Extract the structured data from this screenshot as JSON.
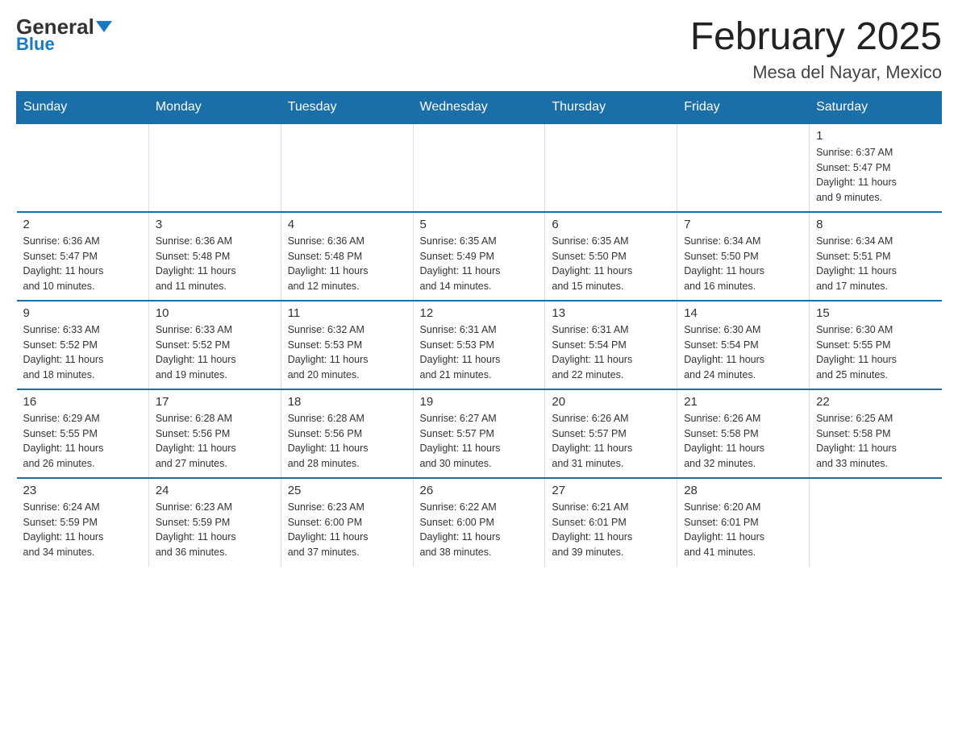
{
  "header": {
    "logo_general": "General",
    "logo_blue": "Blue",
    "title": "February 2025",
    "subtitle": "Mesa del Nayar, Mexico"
  },
  "days_of_week": [
    "Sunday",
    "Monday",
    "Tuesday",
    "Wednesday",
    "Thursday",
    "Friday",
    "Saturday"
  ],
  "weeks": [
    {
      "days": [
        {
          "num": "",
          "info": ""
        },
        {
          "num": "",
          "info": ""
        },
        {
          "num": "",
          "info": ""
        },
        {
          "num": "",
          "info": ""
        },
        {
          "num": "",
          "info": ""
        },
        {
          "num": "",
          "info": ""
        },
        {
          "num": "1",
          "info": "Sunrise: 6:37 AM\nSunset: 5:47 PM\nDaylight: 11 hours\nand 9 minutes."
        }
      ]
    },
    {
      "days": [
        {
          "num": "2",
          "info": "Sunrise: 6:36 AM\nSunset: 5:47 PM\nDaylight: 11 hours\nand 10 minutes."
        },
        {
          "num": "3",
          "info": "Sunrise: 6:36 AM\nSunset: 5:48 PM\nDaylight: 11 hours\nand 11 minutes."
        },
        {
          "num": "4",
          "info": "Sunrise: 6:36 AM\nSunset: 5:48 PM\nDaylight: 11 hours\nand 12 minutes."
        },
        {
          "num": "5",
          "info": "Sunrise: 6:35 AM\nSunset: 5:49 PM\nDaylight: 11 hours\nand 14 minutes."
        },
        {
          "num": "6",
          "info": "Sunrise: 6:35 AM\nSunset: 5:50 PM\nDaylight: 11 hours\nand 15 minutes."
        },
        {
          "num": "7",
          "info": "Sunrise: 6:34 AM\nSunset: 5:50 PM\nDaylight: 11 hours\nand 16 minutes."
        },
        {
          "num": "8",
          "info": "Sunrise: 6:34 AM\nSunset: 5:51 PM\nDaylight: 11 hours\nand 17 minutes."
        }
      ]
    },
    {
      "days": [
        {
          "num": "9",
          "info": "Sunrise: 6:33 AM\nSunset: 5:52 PM\nDaylight: 11 hours\nand 18 minutes."
        },
        {
          "num": "10",
          "info": "Sunrise: 6:33 AM\nSunset: 5:52 PM\nDaylight: 11 hours\nand 19 minutes."
        },
        {
          "num": "11",
          "info": "Sunrise: 6:32 AM\nSunset: 5:53 PM\nDaylight: 11 hours\nand 20 minutes."
        },
        {
          "num": "12",
          "info": "Sunrise: 6:31 AM\nSunset: 5:53 PM\nDaylight: 11 hours\nand 21 minutes."
        },
        {
          "num": "13",
          "info": "Sunrise: 6:31 AM\nSunset: 5:54 PM\nDaylight: 11 hours\nand 22 minutes."
        },
        {
          "num": "14",
          "info": "Sunrise: 6:30 AM\nSunset: 5:54 PM\nDaylight: 11 hours\nand 24 minutes."
        },
        {
          "num": "15",
          "info": "Sunrise: 6:30 AM\nSunset: 5:55 PM\nDaylight: 11 hours\nand 25 minutes."
        }
      ]
    },
    {
      "days": [
        {
          "num": "16",
          "info": "Sunrise: 6:29 AM\nSunset: 5:55 PM\nDaylight: 11 hours\nand 26 minutes."
        },
        {
          "num": "17",
          "info": "Sunrise: 6:28 AM\nSunset: 5:56 PM\nDaylight: 11 hours\nand 27 minutes."
        },
        {
          "num": "18",
          "info": "Sunrise: 6:28 AM\nSunset: 5:56 PM\nDaylight: 11 hours\nand 28 minutes."
        },
        {
          "num": "19",
          "info": "Sunrise: 6:27 AM\nSunset: 5:57 PM\nDaylight: 11 hours\nand 30 minutes."
        },
        {
          "num": "20",
          "info": "Sunrise: 6:26 AM\nSunset: 5:57 PM\nDaylight: 11 hours\nand 31 minutes."
        },
        {
          "num": "21",
          "info": "Sunrise: 6:26 AM\nSunset: 5:58 PM\nDaylight: 11 hours\nand 32 minutes."
        },
        {
          "num": "22",
          "info": "Sunrise: 6:25 AM\nSunset: 5:58 PM\nDaylight: 11 hours\nand 33 minutes."
        }
      ]
    },
    {
      "days": [
        {
          "num": "23",
          "info": "Sunrise: 6:24 AM\nSunset: 5:59 PM\nDaylight: 11 hours\nand 34 minutes."
        },
        {
          "num": "24",
          "info": "Sunrise: 6:23 AM\nSunset: 5:59 PM\nDaylight: 11 hours\nand 36 minutes."
        },
        {
          "num": "25",
          "info": "Sunrise: 6:23 AM\nSunset: 6:00 PM\nDaylight: 11 hours\nand 37 minutes."
        },
        {
          "num": "26",
          "info": "Sunrise: 6:22 AM\nSunset: 6:00 PM\nDaylight: 11 hours\nand 38 minutes."
        },
        {
          "num": "27",
          "info": "Sunrise: 6:21 AM\nSunset: 6:01 PM\nDaylight: 11 hours\nand 39 minutes."
        },
        {
          "num": "28",
          "info": "Sunrise: 6:20 AM\nSunset: 6:01 PM\nDaylight: 11 hours\nand 41 minutes."
        },
        {
          "num": "",
          "info": ""
        }
      ]
    }
  ]
}
